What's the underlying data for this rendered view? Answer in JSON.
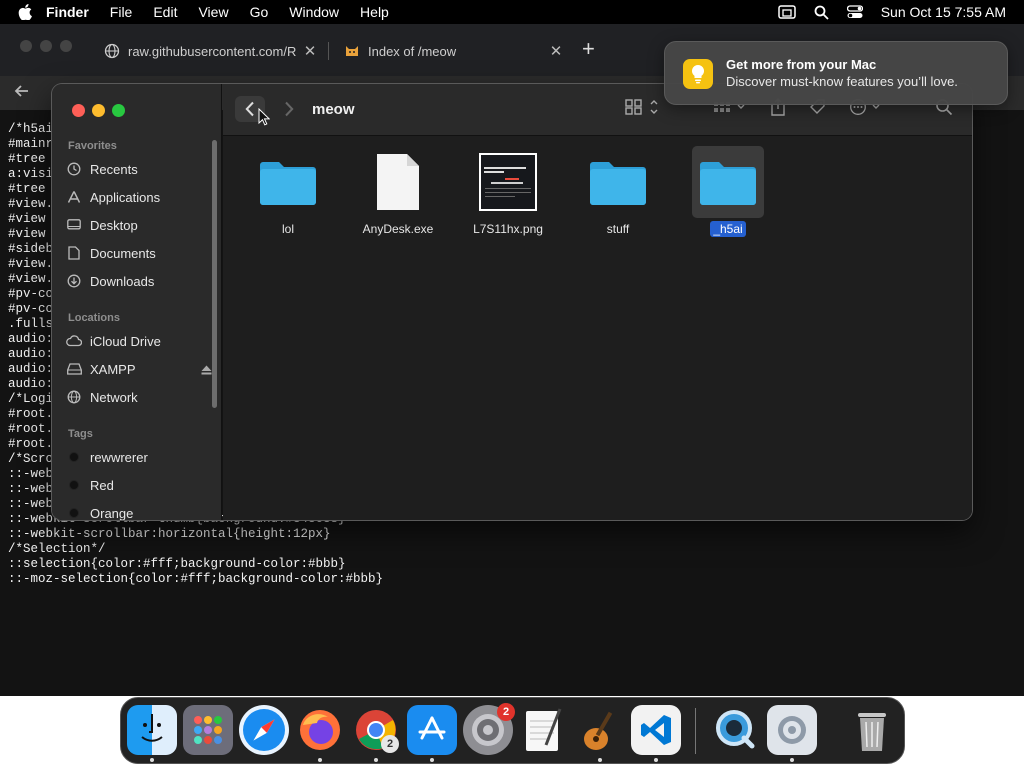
{
  "menubar": {
    "app": "Finder",
    "items": [
      "File",
      "Edit",
      "View",
      "Go",
      "Window",
      "Help"
    ],
    "clock": "Sun Oct 15  7:55 AM"
  },
  "browser": {
    "tabs": [
      {
        "title": "raw.githubusercontent.com/R"
      },
      {
        "title": "Index of /meow"
      }
    ],
    "code_lines": [
      "/*h5ai",
      "#mainr",
      "#tree",
      "a:visi",
      "#tree",
      "#view.",
      "#view",
      "#view",
      "#sideb",
      "#view.",
      "#view.",
      "#pv-co",
      "#pv-co",
      ".fulls",
      "audio:",
      "audio:",
      "audio:",
      "audio:",
      "/*Logi",
      "#root.",
      "#root.",
      "#root.",
      "/*Scro",
      "::-web",
      "::-web",
      "::-web",
      "::-webkit-scrollbar-thumb{background:#343638}",
      "::-webkit-scrollbar:horizontal{height:12px}",
      "/*Selection*/",
      "::selection{color:#fff;background-color:#bbb}",
      "::-moz-selection{color:#fff;background-color:#bbb}"
    ]
  },
  "finder": {
    "title": "meow",
    "sidebar": {
      "favorites_label": "Favorites",
      "favorites": [
        "Recents",
        "Applications",
        "Desktop",
        "Documents",
        "Downloads"
      ],
      "locations_label": "Locations",
      "locations": [
        "iCloud Drive",
        "XAMPP",
        "Network"
      ],
      "tags_label": "Tags",
      "tags": [
        "rewwrerer",
        "Red",
        "Orange"
      ]
    },
    "files": [
      {
        "name": "lol",
        "kind": "folder"
      },
      {
        "name": "AnyDesk.exe",
        "kind": "document"
      },
      {
        "name": "L7S11hx.png",
        "kind": "image"
      },
      {
        "name": "stuff",
        "kind": "folder"
      },
      {
        "name": "_h5ai",
        "kind": "folder",
        "selected": true
      }
    ]
  },
  "notification": {
    "title": "Get more from your Mac",
    "body": "Discover must-know features you’ll love."
  },
  "dock": {
    "chrome_badge": "2",
    "settings_badge": "2"
  },
  "colors": {
    "folder_blue": "#3fb5ea",
    "selection_blue": "#2560d0",
    "notif_icon": "#f5c211"
  }
}
